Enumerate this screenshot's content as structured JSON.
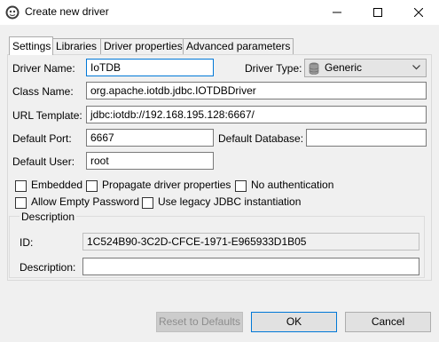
{
  "window": {
    "title": "Create new driver"
  },
  "tabs": [
    {
      "label": "Settings"
    },
    {
      "label": "Libraries"
    },
    {
      "label": "Driver properties"
    },
    {
      "label": "Advanced parameters"
    }
  ],
  "settings": {
    "driver_name": {
      "label": "Driver Name:",
      "value": "IoTDB"
    },
    "driver_type": {
      "label": "Driver Type:",
      "value": "Generic"
    },
    "class_name": {
      "label": "Class Name:",
      "value": "org.apache.iotdb.jdbc.IOTDBDriver"
    },
    "url_template": {
      "label": "URL Template:",
      "value": "jdbc:iotdb://192.168.195.128:6667/"
    },
    "default_port": {
      "label": "Default Port:",
      "value": "6667"
    },
    "default_database": {
      "label": "Default Database:",
      "value": ""
    },
    "default_user": {
      "label": "Default User:",
      "value": "root"
    }
  },
  "checkboxes": [
    {
      "label": "Embedded",
      "checked": false
    },
    {
      "label": "Propagate driver properties",
      "checked": false
    },
    {
      "label": "No authentication",
      "checked": false
    },
    {
      "label": "Allow Empty Password",
      "checked": false
    },
    {
      "label": "Use legacy JDBC instantiation",
      "checked": false
    }
  ],
  "description_group": {
    "title": "Description",
    "id_label": "ID:",
    "id_value": "1C524B90-3C2D-CFCE-1971-E965933D1B05",
    "description_label": "Description:",
    "description_value": ""
  },
  "buttons": {
    "reset": "Reset to Defaults",
    "ok": "OK",
    "cancel": "Cancel"
  },
  "icons": {
    "app": "dbeaver-beaver-icon",
    "driver_type": "database-icon",
    "dropdown": "chevron-down-icon",
    "minimize": "minimize-icon",
    "maximize": "maximize-icon",
    "close": "close-icon"
  }
}
